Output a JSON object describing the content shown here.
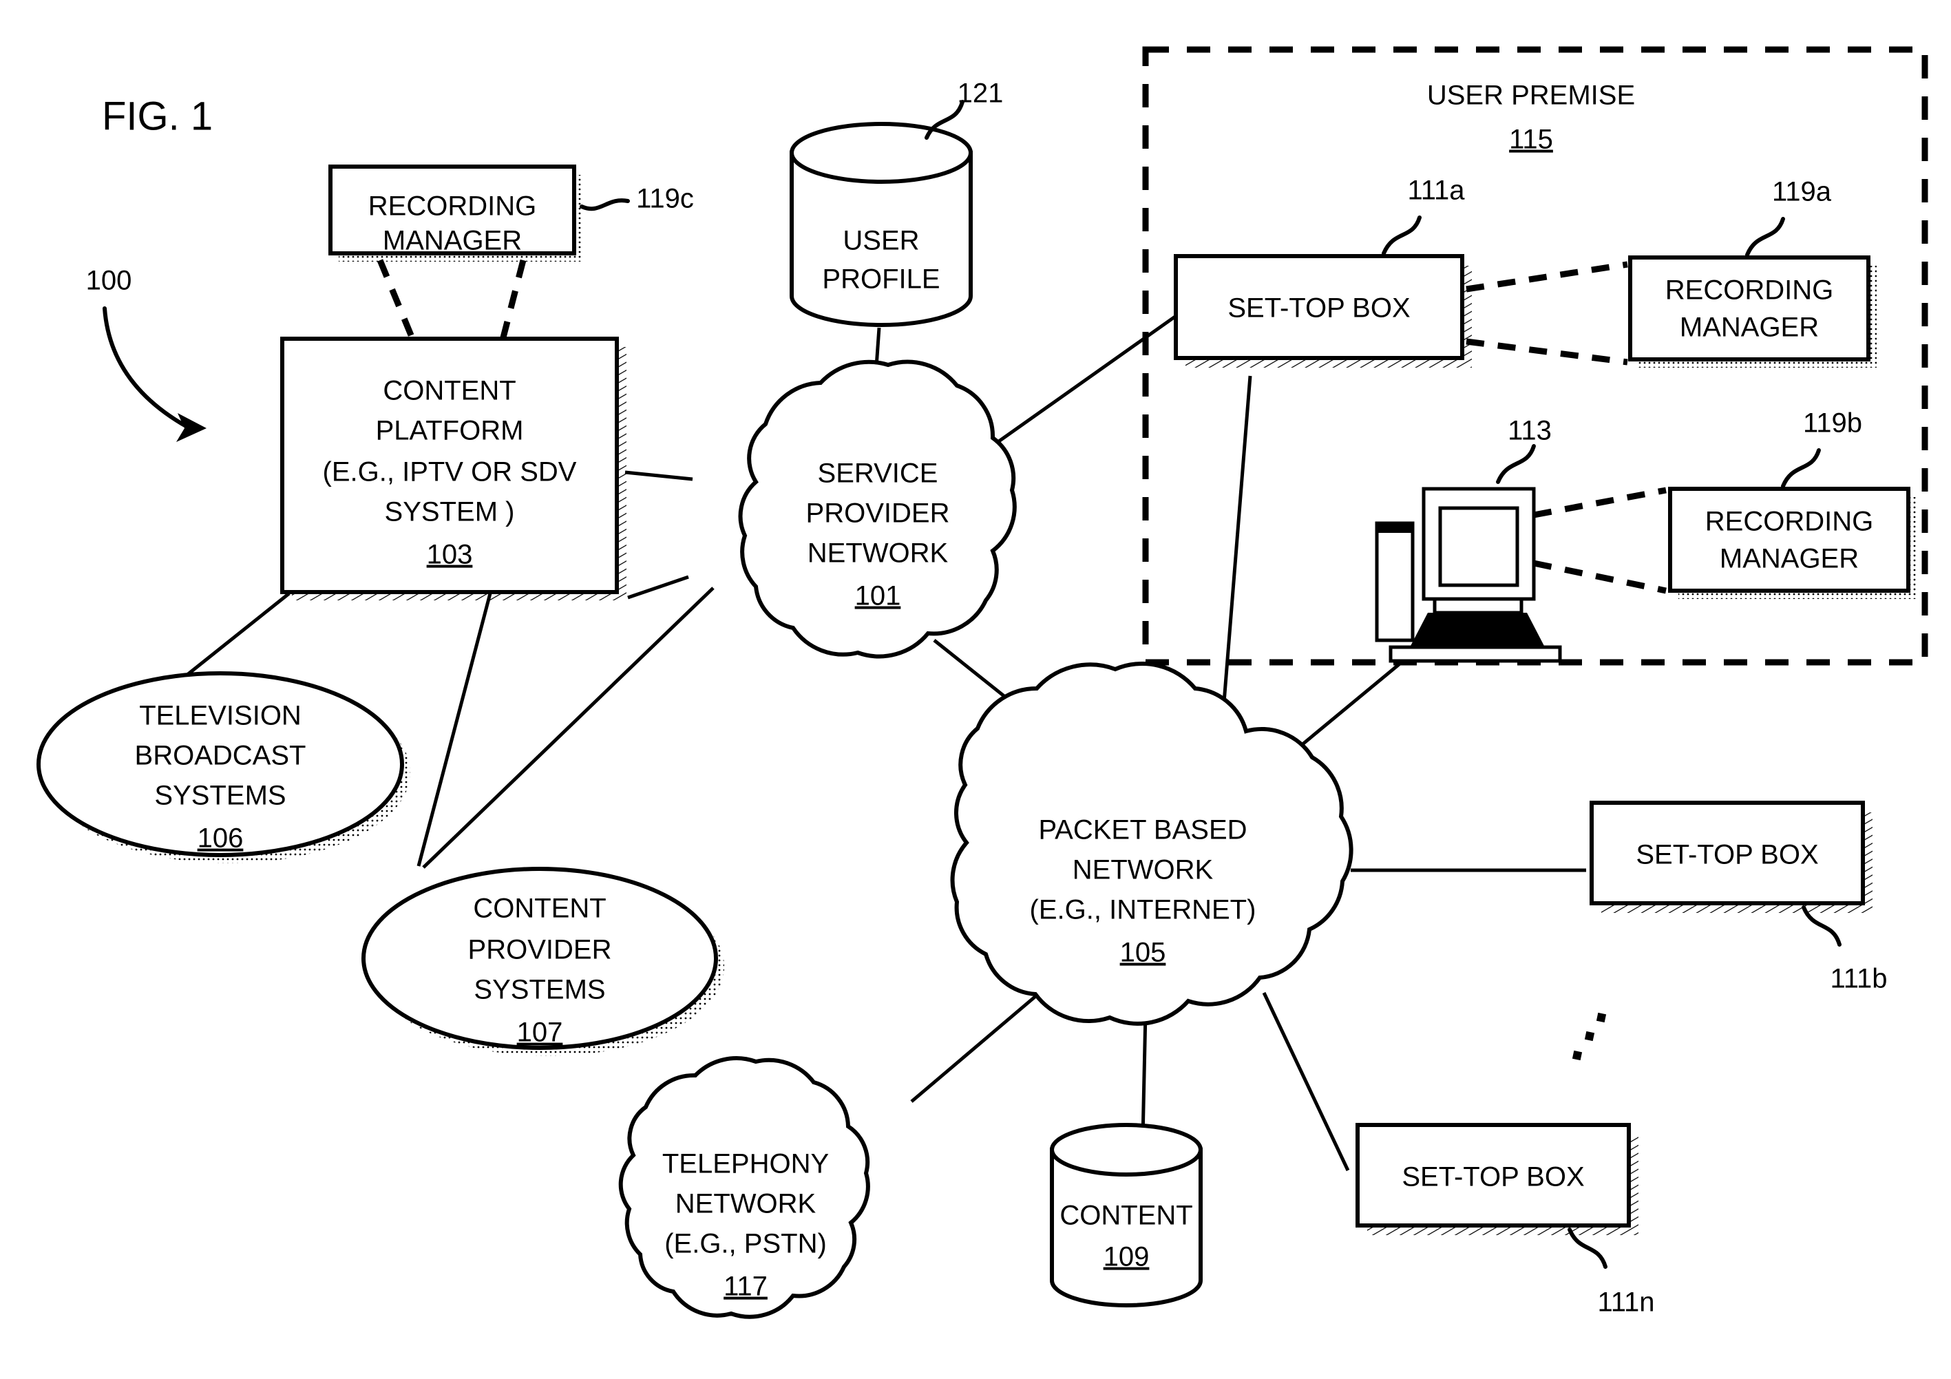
{
  "figure": {
    "title": "FIG. 1",
    "system_ref": "100"
  },
  "nodes": {
    "recording_manager_c": {
      "label_line1": "RECORDING",
      "label_line2": "MANAGER",
      "ref": "119c"
    },
    "content_platform": {
      "label_line1": "CONTENT",
      "label_line2": "PLATFORM",
      "label_line3": "(E.G., IPTV OR SDV",
      "label_line4": "SYSTEM )",
      "ref": "103"
    },
    "user_profile": {
      "label_line1": "USER",
      "label_line2": "PROFILE",
      "ref": "121"
    },
    "service_provider_network": {
      "label_line1": "SERVICE",
      "label_line2": "PROVIDER",
      "label_line3": "NETWORK",
      "ref": "101"
    },
    "television_broadcast_systems": {
      "label_line1": "TELEVISION",
      "label_line2": "BROADCAST",
      "label_line3": "SYSTEMS",
      "ref": "106"
    },
    "content_provider_systems": {
      "label_line1": "CONTENT",
      "label_line2": "PROVIDER",
      "label_line3": "SYSTEMS",
      "ref": "107"
    },
    "packet_based_network": {
      "label_line1": "PACKET BASED",
      "label_line2": "NETWORK",
      "label_line3": "(E.G., INTERNET)",
      "ref": "105"
    },
    "telephony_network": {
      "label_line1": "TELEPHONY",
      "label_line2": "NETWORK",
      "label_line3": "(E.G., PSTN)",
      "ref": "117"
    },
    "content_store": {
      "label_line1": "CONTENT",
      "ref": "109"
    },
    "user_premise": {
      "label_line1": "USER PREMISE",
      "ref": "115"
    },
    "set_top_box_a": {
      "label_line1": "SET-TOP BOX",
      "ref": "111a"
    },
    "recording_manager_a": {
      "label_line1": "RECORDING",
      "label_line2": "MANAGER",
      "ref": "119a"
    },
    "computer": {
      "ref": "113"
    },
    "recording_manager_b": {
      "label_line1": "RECORDING",
      "label_line2": "MANAGER",
      "ref": "119b"
    },
    "set_top_box_b": {
      "label_line1": "SET-TOP BOX",
      "ref": "111b"
    },
    "set_top_box_n": {
      "label_line1": "SET-TOP BOX",
      "ref": "111n"
    }
  },
  "colors": {
    "ink": "#000000",
    "paper": "#ffffff"
  }
}
